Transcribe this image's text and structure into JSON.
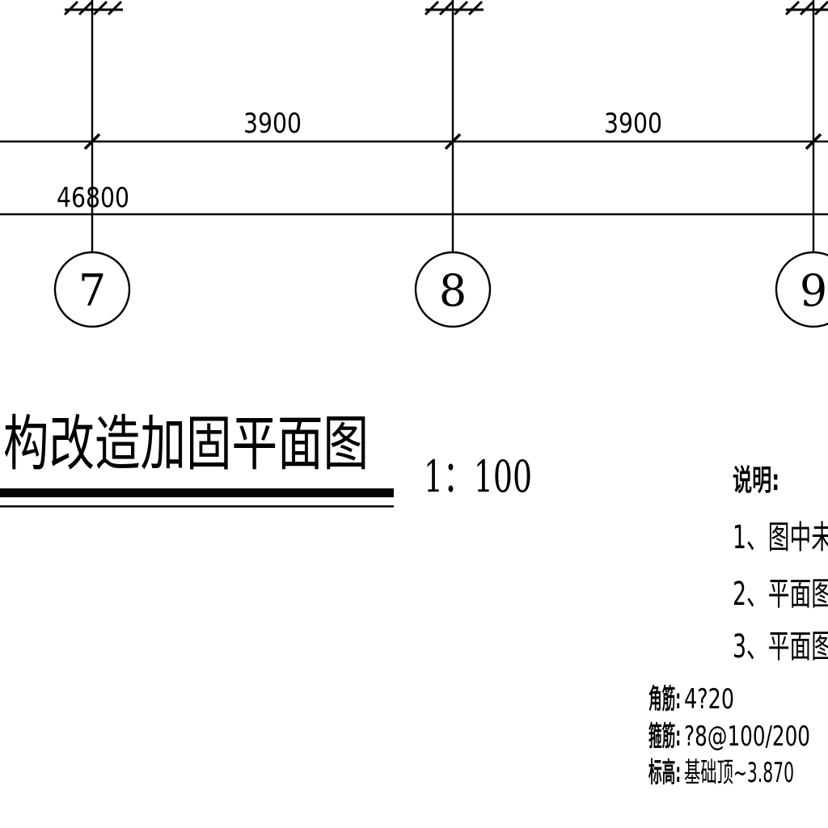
{
  "drawing": {
    "dimensions": {
      "span_7_8": "3900",
      "span_8_9": "3900",
      "total": "46800"
    },
    "axes": [
      "7",
      "8",
      "9"
    ],
    "title": "构改造加固平面图",
    "scale": "1：100",
    "notes": {
      "heading": "说明:",
      "items": [
        "1、图中未",
        "2、平面图",
        "3、平面图"
      ]
    },
    "column_spec": {
      "main_rebar_label": "角筋:",
      "main_rebar_value": "4?20",
      "stirrup_label": "箍筋:",
      "stirrup_value": "?8@100/200",
      "elevation_label": "标高:",
      "elevation_value": "基础顶~3.870"
    }
  }
}
